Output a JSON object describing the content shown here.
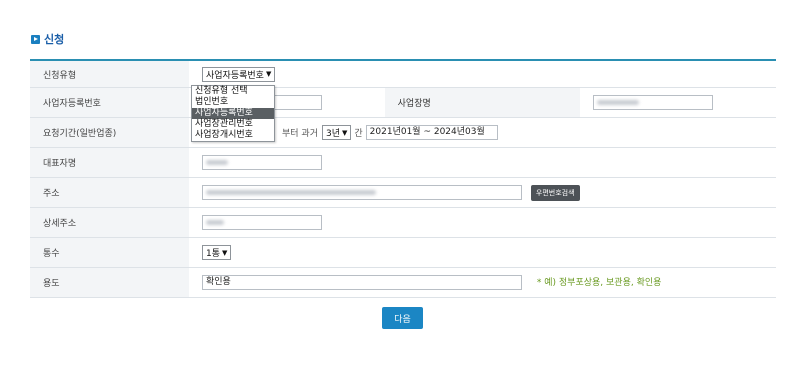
{
  "section": {
    "title": "신청"
  },
  "form": {
    "type_label": "신청유형",
    "type_value": "사업자등록번호",
    "brn_label": "사업자등록번호",
    "bizname_label": "사업장명",
    "period_label": "요청기간(일반업종)",
    "period_prefix": "부터 과거",
    "period_years": "3년",
    "period_mid": "간",
    "period_range": "2021년01월 ~ 2024년03월",
    "rep_label": "대표자명",
    "addr_label": "주소",
    "zip_button": "우편번호검색",
    "addr_detail_label": "상세주소",
    "copies_label": "통수",
    "copies_value": "1통",
    "purpose_label": "용도",
    "purpose_value": "확인용",
    "purpose_hint": "* 예) 정부포상용, 보관용, 확인용"
  },
  "dropdown": {
    "options": [
      "신청유형 선택",
      "법인번호",
      "사업자등록번호",
      "사업장관리번호",
      "사업장개시번호"
    ],
    "selected_index": 2
  },
  "next_button": "다음"
}
